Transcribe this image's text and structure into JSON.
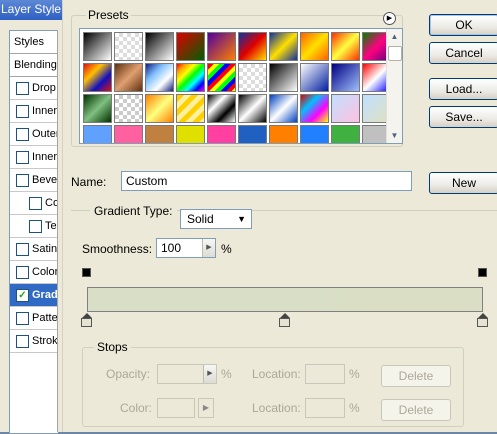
{
  "bg_dialog": {
    "title": "Layer Style",
    "items": [
      {
        "label": "Styles",
        "type": "header"
      },
      {
        "label": "Blending Options",
        "type": "header"
      },
      {
        "label": "Drop Shadow",
        "checked": false,
        "indent": 0
      },
      {
        "label": "Inner Shadow",
        "checked": false,
        "indent": 0
      },
      {
        "label": "Outer Glow",
        "checked": false,
        "indent": 0
      },
      {
        "label": "Inner Glow",
        "checked": false,
        "indent": 0
      },
      {
        "label": "Bevel and Emboss",
        "checked": false,
        "indent": 0
      },
      {
        "label": "Contour",
        "checked": false,
        "indent": 1
      },
      {
        "label": "Texture",
        "checked": false,
        "indent": 1
      },
      {
        "label": "Satin",
        "checked": false,
        "indent": 0
      },
      {
        "label": "Color Overlay",
        "checked": false,
        "indent": 0
      },
      {
        "label": "Gradient Overlay",
        "checked": true,
        "indent": 0,
        "selected": true
      },
      {
        "label": "Pattern Overlay",
        "checked": false,
        "indent": 0
      },
      {
        "label": "Stroke",
        "checked": false,
        "indent": 0
      }
    ]
  },
  "presets": {
    "label": "Presets",
    "swatches": [
      "linear-gradient(135deg,#000,#fff)",
      "repeating-conic-gradient(#ddd 0 25%,#fff 0 50%) 0 0/8px 8px",
      "linear-gradient(135deg,#000,#fff)",
      "linear-gradient(135deg,#e00000,#006000)",
      "linear-gradient(135deg,#5000a0,#ff8000)",
      "linear-gradient(135deg,#1030a0,#e00000,#ffe000)",
      "linear-gradient(135deg,#1030a0,#ffe000,#1030a0)",
      "linear-gradient(135deg,#ff6000,#ffe000,#ff6000)",
      "linear-gradient(135deg,#ff3000,#ffff40,#ff3000)",
      "linear-gradient(135deg,#008000,#ff0080,#600080)",
      "linear-gradient(135deg,#e01010,#ffc000,#1010c0,#e01010)",
      "linear-gradient(135deg,#603010,#e0a070,#603010)",
      "linear-gradient(135deg,#102080,#80c0ff,#fff,#102080)",
      "linear-gradient(135deg,red,orange,yellow,lime,cyan,blue,magenta)",
      "repeating-linear-gradient(135deg,red 0 4px,yellow 4px 8px,lime 8px 12px,blue 12px 16px)",
      "repeating-conic-gradient(#ddd 0 25%,#fff 0 50%) 0 0/8px 8px",
      "linear-gradient(135deg,#000,#808080,#fff)",
      "linear-gradient(135deg,#fff,#0020a0)",
      "linear-gradient(135deg,#000080,#a0c0ff)",
      "linear-gradient(135deg,#ff0000,#fff,#0000ff)",
      "linear-gradient(135deg,#003000,#80c080,#003000)",
      "repeating-conic-gradient(#ccc 0 25%,#fff 0 50%) 0 0/8px 8px",
      "linear-gradient(135deg,#ff8000,#ffff80,#ff8000)",
      "repeating-linear-gradient(135deg,#ffd000 0 5px,#fff0a0 5px 10px)",
      "linear-gradient(135deg,#000,#fff,#000,#fff)",
      "linear-gradient(135deg,#000,#fff,#000)",
      "linear-gradient(135deg,#0040c0,#fff,#0040c0)",
      "linear-gradient(135deg,#e00000,#00c0ff,#ff00ff,#ffff00)",
      "linear-gradient(135deg,#c0e0ff,#ffc0e0)",
      "linear-gradient(135deg,#c0e0ff,#e0e0c0)",
      "linear-gradient(#60a0ff,#60a0ff)",
      "linear-gradient(#ff60a0,#ff60a0)",
      "linear-gradient(#c08040,#c08040)",
      "linear-gradient(#e0e000,#e0e000)",
      "linear-gradient(#ff40a0,#ff40a0)",
      "linear-gradient(#2060c0,#2060c0)",
      "linear-gradient(#ff8000,#ff8000)",
      "linear-gradient(#2080ff,#2080ff)",
      "linear-gradient(#40b040,#40b040)",
      "linear-gradient(#c0c0c0,#c0c0c0)"
    ]
  },
  "buttons": {
    "ok": "OK",
    "cancel": "Cancel",
    "load": "Load...",
    "save": "Save...",
    "new": "New",
    "delete_opacity": "Delete",
    "delete_color": "Delete"
  },
  "name": {
    "label": "Name:",
    "value": "Custom"
  },
  "gradient_type": {
    "label": "Gradient Type:",
    "value": "Solid"
  },
  "smoothness": {
    "label": "Smoothness:",
    "value": "100",
    "unit": "%"
  },
  "gradient": {
    "colors": [
      "#d9dfc6",
      "#d9dec5"
    ],
    "opacity_stops": [
      0,
      1
    ],
    "color_stops": [
      0,
      0.5,
      1
    ],
    "stop_color": "#e6e4d0"
  },
  "stops": {
    "label": "Stops",
    "opacity_label": "Opacity:",
    "opacity_unit": "%",
    "location_label": "Location:",
    "location_unit": "%",
    "color_label": "Color:"
  }
}
